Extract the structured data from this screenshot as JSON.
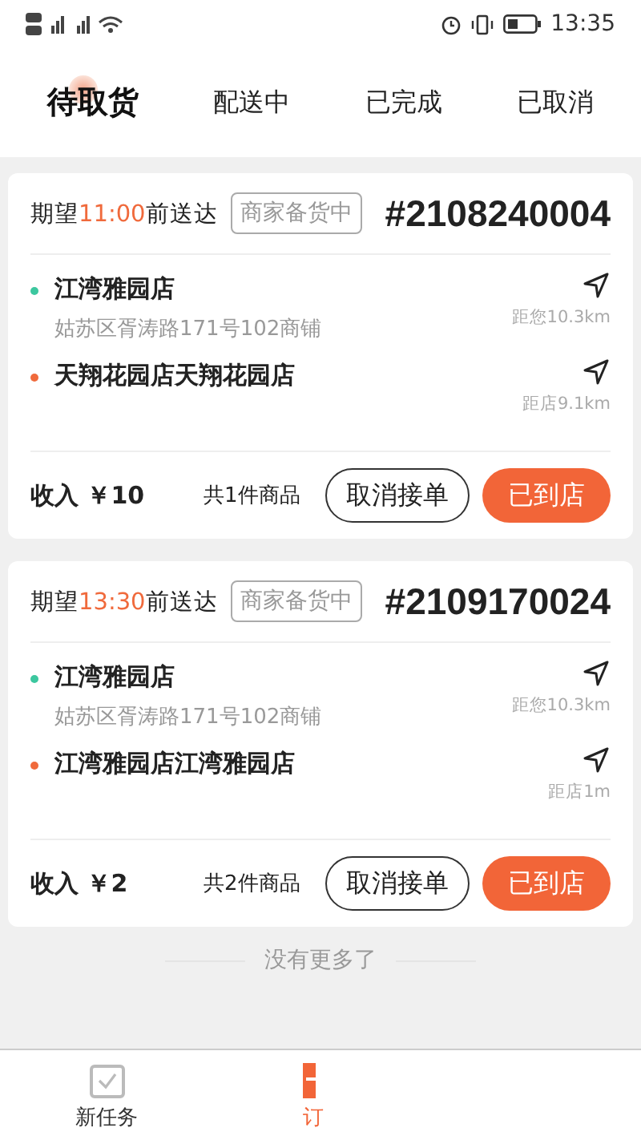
{
  "status_bar": {
    "time": "13:35"
  },
  "tabs": [
    {
      "label": "待取货",
      "selected": true
    },
    {
      "label": "配送中",
      "selected": false
    },
    {
      "label": "已完成",
      "selected": false
    },
    {
      "label": "已取消",
      "selected": false
    }
  ],
  "orders": [
    {
      "expect_prefix": "期望",
      "expect_time": "11:00",
      "expect_suffix": "前送达",
      "status": "商家备货中",
      "number": "#2108240004",
      "stops": [
        {
          "color": "#3cc79f",
          "name": "江湾雅园店",
          "address": "姑苏区胥涛路171号102商铺",
          "distance": "距您10.3km"
        },
        {
          "color": "#f06a3c",
          "name": "天翔花园店天翔花园店",
          "distance": "距店9.1km"
        }
      ],
      "income": "收入 ￥10",
      "item_count": "共1件商品",
      "cancel_button": "取消接单",
      "arrive_button": "已到店"
    },
    {
      "expect_prefix": "期望",
      "expect_time": "13:30",
      "expect_suffix": "前送达",
      "status": "商家备货中",
      "number": "#2109170024",
      "stops": [
        {
          "color": "#3cc79f",
          "name": "江湾雅园店",
          "address": "姑苏区胥涛路171号102商铺",
          "distance": "距您10.3km"
        },
        {
          "color": "#f06a3c",
          "name": "江湾雅园店江湾雅园店",
          "distance": "距店1m"
        }
      ],
      "income": "收入 ￥2",
      "item_count": "共2件商品",
      "cancel_button": "取消接单",
      "arrive_button": "已到店"
    }
  ],
  "end_note": "没有更多了",
  "nav": [
    {
      "label": "新任务",
      "selected": false
    },
    {
      "label": "订",
      "selected": true
    }
  ]
}
